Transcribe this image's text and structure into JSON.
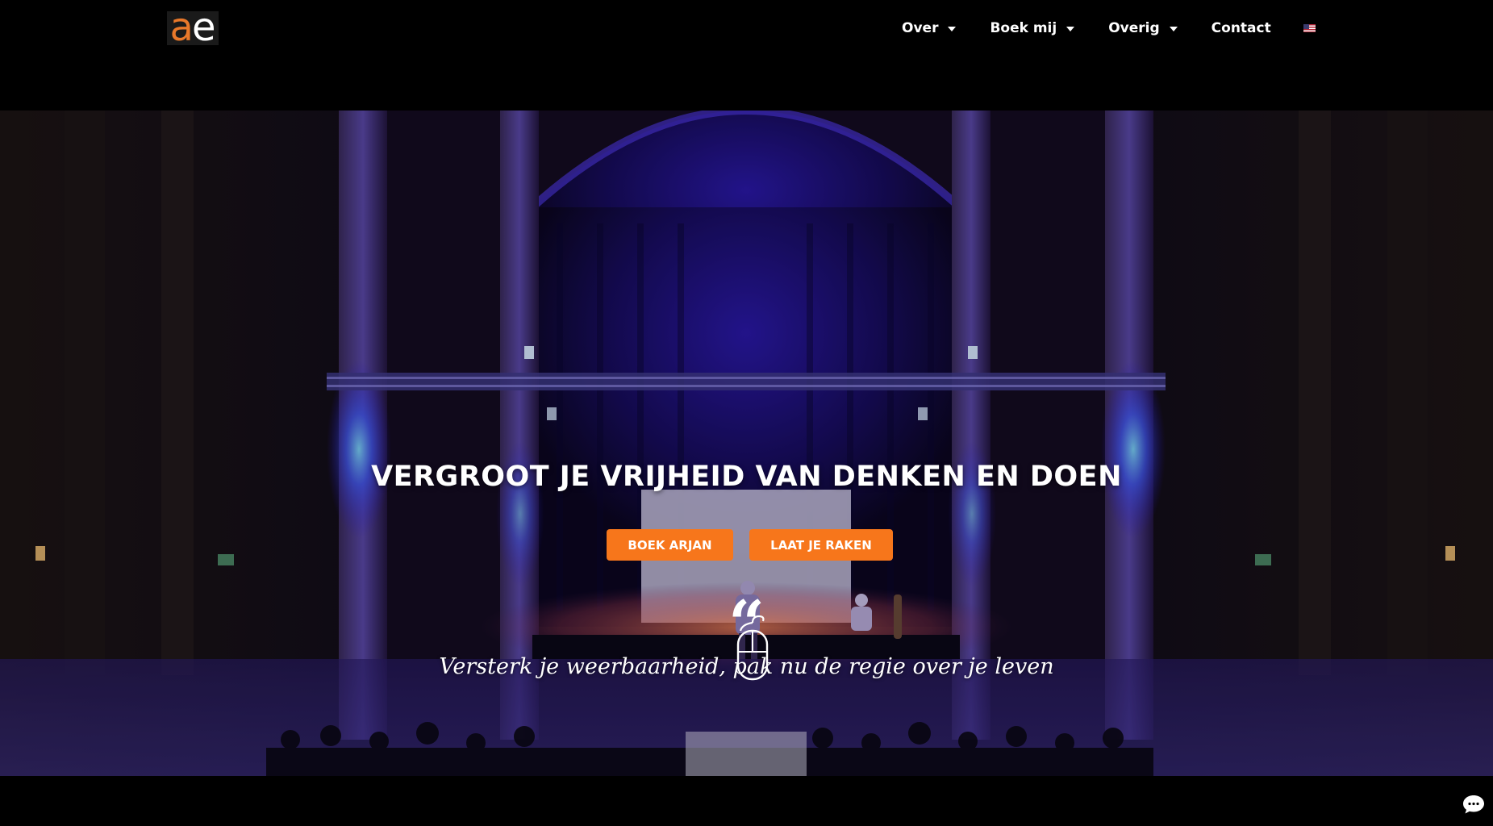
{
  "header": {
    "logo": {
      "letter_a": "a",
      "letter_e": "e"
    },
    "nav": {
      "over": "Over",
      "boek": "Boek mij",
      "overig": "Overig",
      "contact": "Contact",
      "language_icon": "us-flag-icon"
    }
  },
  "hero": {
    "headline": "VERGROOT JE VRIJHEID VAN DENKEN EN DOEN",
    "buttons": {
      "boek": "BOEK ARJAN",
      "raak": "LAAT JE RAKEN"
    },
    "quote_mark": "“",
    "quote": "Versterk je weerbaarheid, pak nu de regie over je leven",
    "scroll_icon": "mouse-scroll-icon"
  },
  "widgets": {
    "chat_icon": "chat-bubble-icon"
  },
  "colors": {
    "accent": "#f7761b",
    "logo_orange": "#e8782a",
    "background": "#000000",
    "stage_light": "#4a2fd6"
  }
}
